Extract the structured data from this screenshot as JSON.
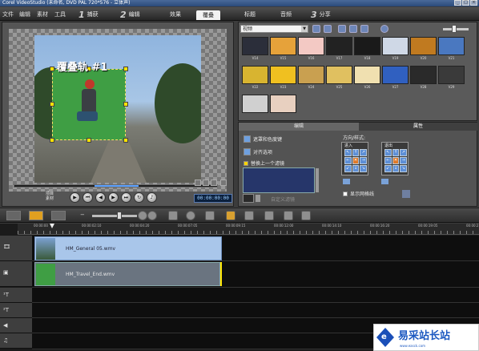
{
  "window": {
    "title": "Corel VideoStudio (未命名, DVD PAL 720*576 - 立体声)",
    "controls": [
      "_",
      "□",
      "×"
    ]
  },
  "menu": {
    "items": [
      "文件",
      "编辑",
      "素材",
      "工具"
    ]
  },
  "steps": [
    {
      "num": "1",
      "label": "捕获"
    },
    {
      "num": "2",
      "label": "编辑"
    },
    {
      "num": "",
      "label": "效果"
    },
    {
      "num": "",
      "label": "覆叠"
    },
    {
      "num": "",
      "label": "标题"
    },
    {
      "num": "",
      "label": "音频"
    },
    {
      "num": "3",
      "label": "分享"
    }
  ],
  "selected_step": "覆叠",
  "preview": {
    "overlay_label": "覆叠轨 #1",
    "project_clip": [
      "项目",
      "素材"
    ],
    "timecode": "00:00:00:00",
    "transport": [
      "play-icon",
      "prev-icon",
      "rewind-icon",
      "forward-icon",
      "next-icon",
      "repeat-icon",
      "volume-icon"
    ]
  },
  "library": {
    "dropdown": "视频",
    "thumbs": [
      {
        "label": "V14",
        "color": "#2b2e3a"
      },
      {
        "label": "V15",
        "color": "#e6a23a"
      },
      {
        "label": "V16",
        "color": "#f3c9c4"
      },
      {
        "label": "V17",
        "color": "#222222"
      },
      {
        "label": "V18",
        "color": "#1a1a1a"
      },
      {
        "label": "V19",
        "color": "#cfd8e6"
      },
      {
        "label": "V20",
        "color": "#c07a20"
      },
      {
        "label": "V21",
        "color": "#4a78c0"
      },
      {
        "label": "V22",
        "color": "#d8b430"
      },
      {
        "label": "V23",
        "color": "#f0c020"
      },
      {
        "label": "V24",
        "color": "#c9a050"
      },
      {
        "label": "V25",
        "color": "#e0c060"
      },
      {
        "label": "V26",
        "color": "#f0e0b0"
      },
      {
        "label": "V27",
        "color": "#3060c0"
      },
      {
        "label": "V28",
        "color": "#2a2a2a"
      },
      {
        "label": "V29",
        "color": "#3a3a3a"
      },
      {
        "label": "",
        "color": "#d0d0d0"
      },
      {
        "label": "",
        "color": "#e8d0c0"
      }
    ]
  },
  "options": {
    "tabs": [
      "编辑",
      "属性"
    ],
    "mask_label": "遮罩和色度键",
    "align_label": "对齐选项",
    "replace_filter": "替换上一个滤镜",
    "custom_filter": "自定义滤镜",
    "direction_style": "方向/样式:",
    "enter": "进入",
    "exit": "退出",
    "show_grid": "显示网格线"
  },
  "timeline": {
    "ruler": [
      "00:00:00",
      "00:00:02:10",
      "00:00:04:20",
      "00:00:07:05",
      "00:00:09:15",
      "00:00:12:00",
      "00:00:14:10",
      "00:00:16:20",
      "00:00:19:05",
      "00:00:21:15"
    ],
    "clips": [
      {
        "name": "HM_General 05.wmv"
      },
      {
        "name": "HM_Travel_End.wmv"
      }
    ],
    "track_icons": [
      "video-track-icon",
      "overlay-track-icon",
      "title-track-1-icon",
      "title-track-2-icon",
      "voice-track-icon",
      "music-track-icon"
    ]
  },
  "watermark": {
    "cn": "易采站长站",
    "en": "www.easck.com"
  }
}
